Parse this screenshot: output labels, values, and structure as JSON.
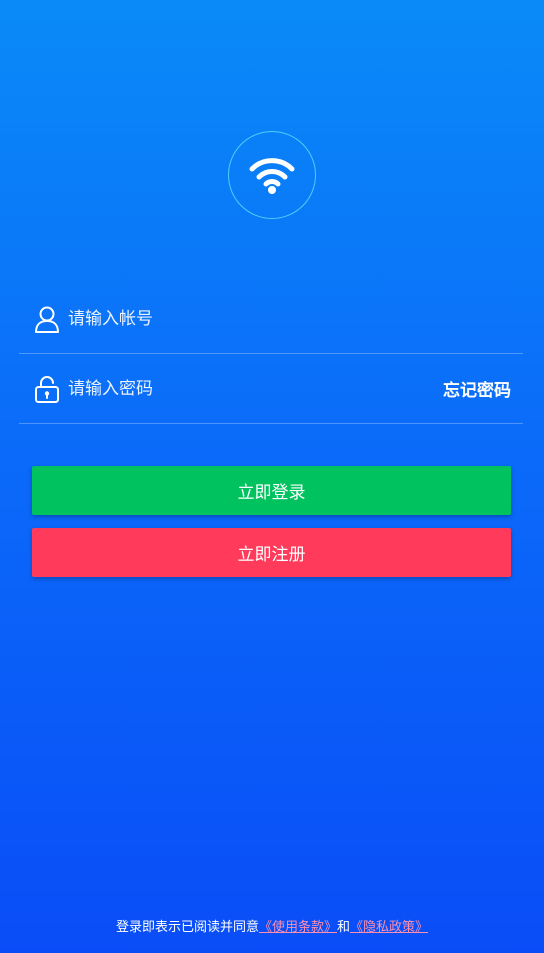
{
  "colors": {
    "login_button": "#00c35f",
    "register_button": "#ff3a5a",
    "link": "#ff8fb0",
    "logo_ring": "#5adcff"
  },
  "logo": {
    "icon": "wifi-icon"
  },
  "account": {
    "icon": "user-icon",
    "placeholder": "请输入帐号",
    "value": ""
  },
  "password": {
    "icon": "lock-icon",
    "placeholder": "请输入密码",
    "value": "",
    "forgot_label": "忘记密码"
  },
  "buttons": {
    "login_label": "立即登录",
    "register_label": "立即注册"
  },
  "agreement": {
    "prefix": "登录即表示已阅读并同意",
    "terms_link": "《使用条款》",
    "and": "和",
    "privacy_link": "《隐私政策》"
  }
}
